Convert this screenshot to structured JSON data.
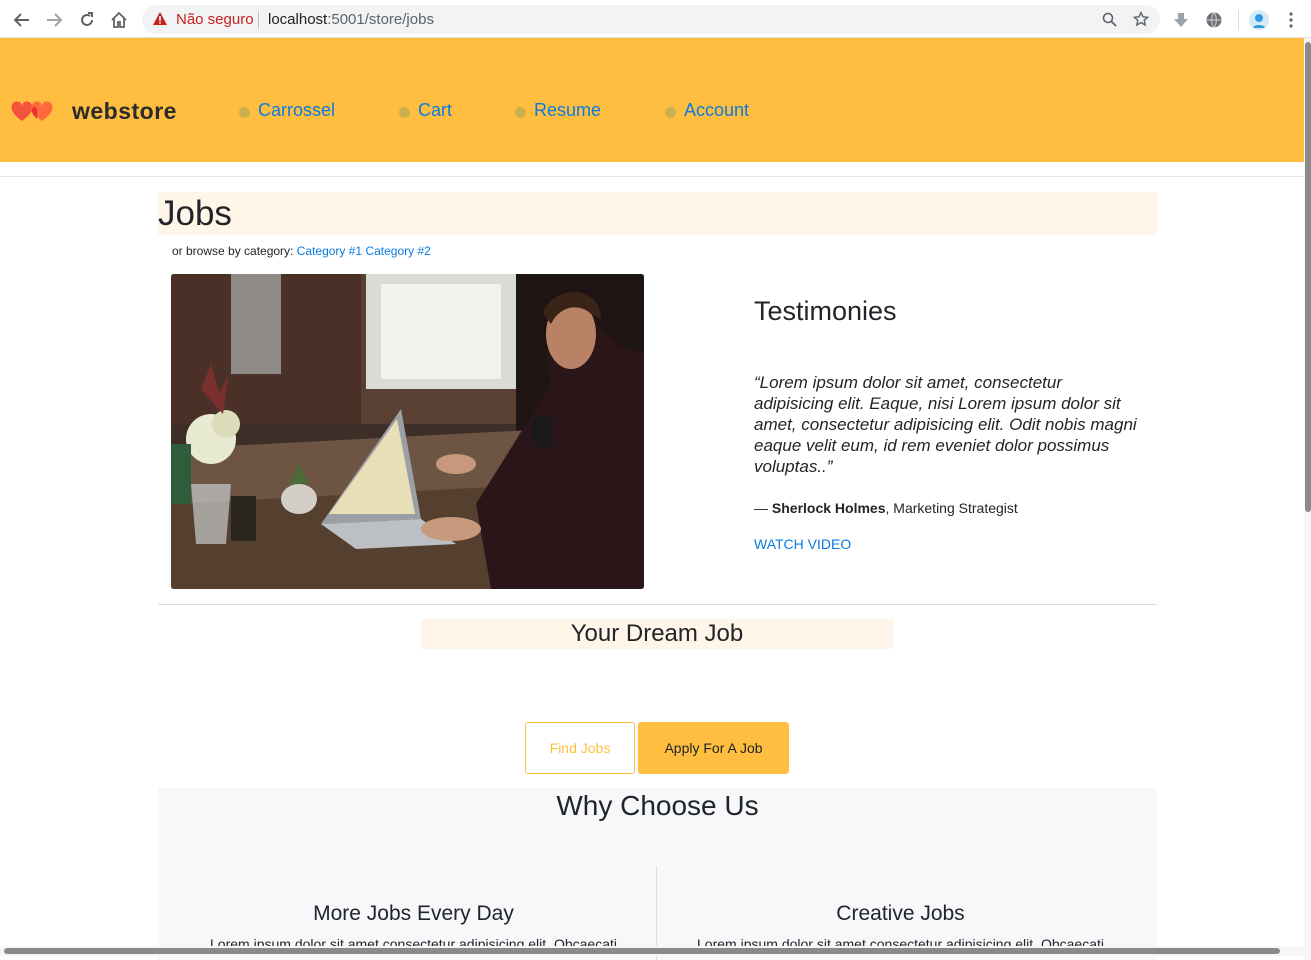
{
  "browser": {
    "security_label": "Não seguro",
    "url_host": "localhost",
    "url_path": ":5001/store/jobs"
  },
  "header": {
    "logo_text": "webstore",
    "nav": [
      "Carrossel",
      "Cart",
      "Resume",
      "Account"
    ],
    "background_color": "#ffbe40",
    "link_color": "#0a7be0"
  },
  "jobs": {
    "title": "Jobs",
    "browse_prefix": "or browse by category:",
    "categories": [
      "Category #1",
      "Category #2"
    ]
  },
  "testimonies": {
    "title": "Testimonies",
    "quote": "“Lorem ipsum dolor sit amet, consectetur adipisicing elit. Eaque, nisi Lorem ipsum dolor sit amet, consectetur adipisicing elit. Odit nobis magni eaque velit eum, id rem eveniet dolor possimus voluptas..”",
    "author_dash": "— ",
    "author_name": "Sherlock Holmes",
    "author_role": ", Marketing Strategist",
    "watch_label": "WATCH VIDEO"
  },
  "dream": {
    "title": "Your Dream Job",
    "find_label": "Find Jobs",
    "apply_label": "Apply For A Job"
  },
  "why": {
    "title": "Why Choose Us",
    "features": [
      {
        "title": "More Jobs Every Day",
        "text": "Lorem ipsum dolor sit amet consectetur adipisicing elit. Obcaecati"
      },
      {
        "title": "Creative Jobs",
        "text": "Lorem ipsum dolor sit amet consectetur adipisicing elit. Obcaecati"
      }
    ]
  }
}
